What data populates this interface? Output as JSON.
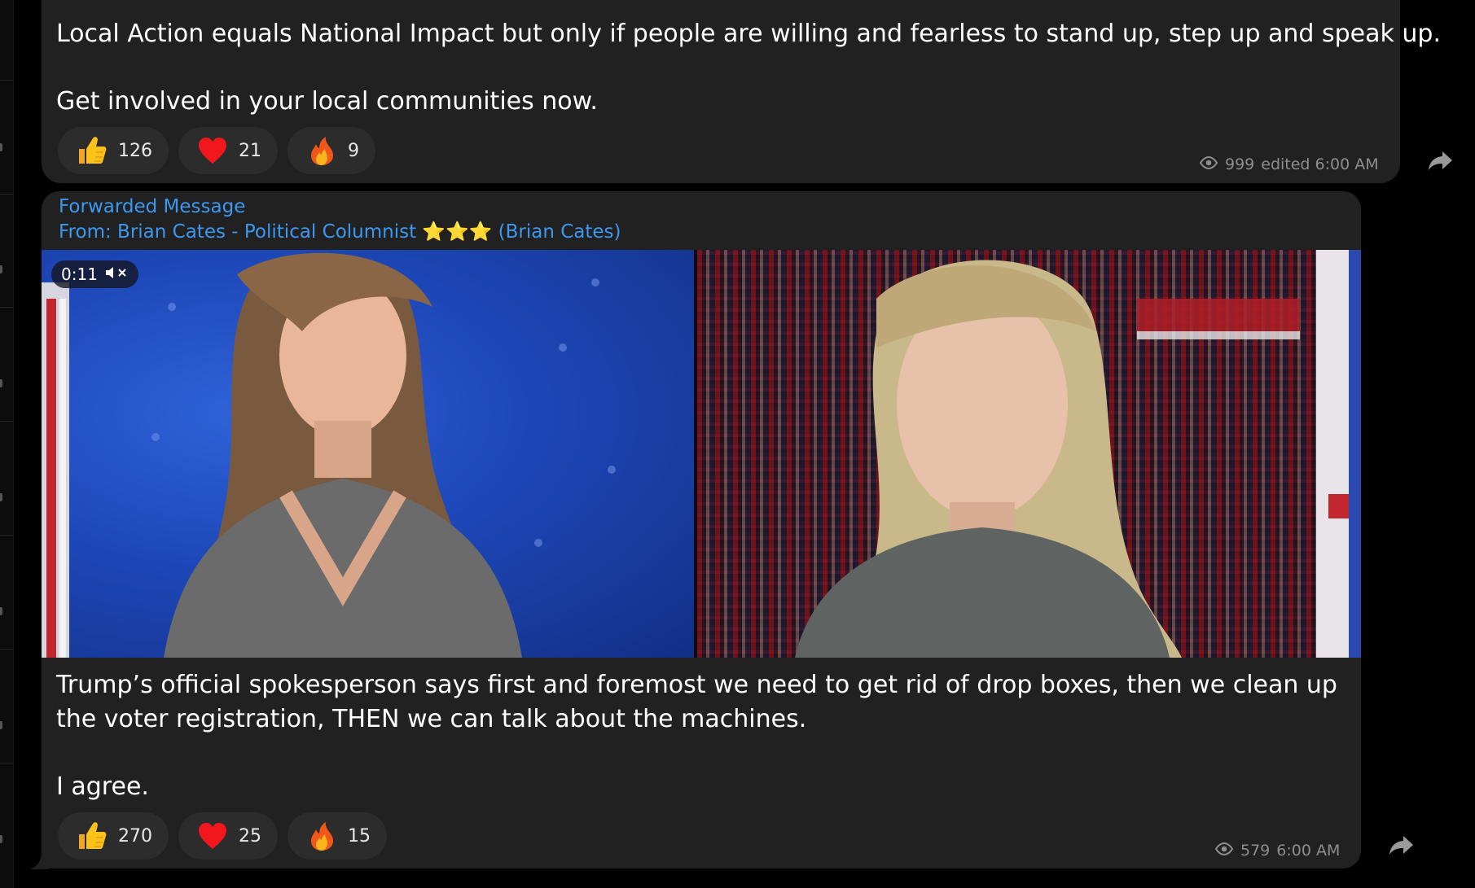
{
  "message1": {
    "text_line1": "Local Action equals National Impact but only if people are willing and fearless to stand up, step up and speak up.",
    "text_line2": "Get involved in your local communities now.",
    "reactions": [
      {
        "emoji": "thumbs-up-icon",
        "count": "126"
      },
      {
        "emoji": "heart-icon",
        "count": "21"
      },
      {
        "emoji": "fire-icon",
        "count": "9"
      }
    ],
    "views": "999",
    "time": "edited 6:00 AM"
  },
  "message2": {
    "forward_label": "Forwarded Message",
    "from_prefix": "From:",
    "from_name": "Brian Cates - Political Columnist ⭐⭐⭐ (Brian Cates)",
    "video_time": "0:11",
    "text_line1": "Trump’s official spokesperson says first and foremost we need to get rid of drop boxes, then we clean up",
    "text_line2": "the voter registration, THEN we can talk about the machines.",
    "text_line3": "I agree.",
    "reactions": [
      {
        "emoji": "thumbs-up-icon",
        "count": "270"
      },
      {
        "emoji": "heart-icon",
        "count": "25"
      },
      {
        "emoji": "fire-icon",
        "count": "15"
      }
    ],
    "views": "579",
    "time": "6:00 AM"
  },
  "colors": {
    "bubble": "#212121",
    "link": "#3b98f0",
    "meta": "#8d8d8d"
  }
}
